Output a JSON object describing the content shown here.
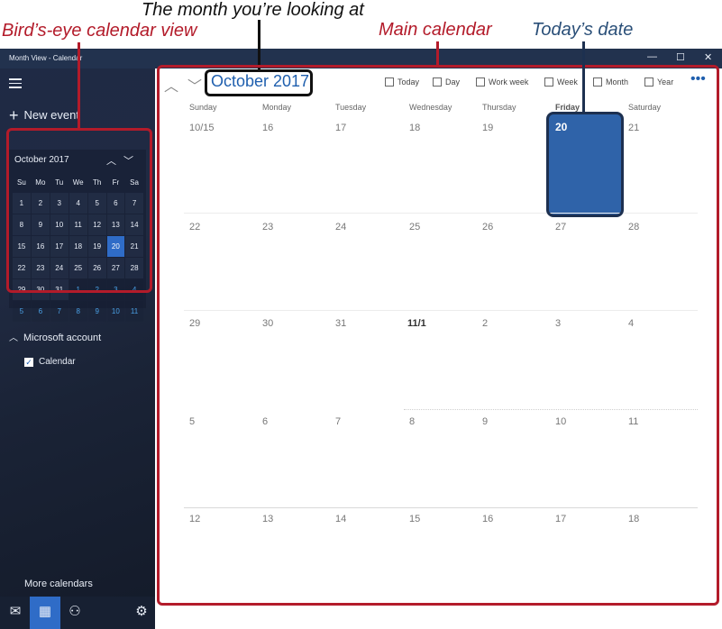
{
  "callouts": {
    "month_looking": "The month you’re looking at",
    "birds_eye": "Bird’s-eye calendar view",
    "main_calendar": "Main calendar",
    "todays_date": "Today’s date"
  },
  "window": {
    "title": "Month View - Calendar",
    "minimize": "—",
    "maximize": "☐",
    "close": "✕"
  },
  "sidebar": {
    "new_event": "New event",
    "mini_calendar": {
      "month": "October 2017",
      "weekdays": [
        "Su",
        "Mo",
        "Tu",
        "We",
        "Th",
        "Fr",
        "Sa"
      ],
      "weeks": [
        [
          "1",
          "2",
          "3",
          "4",
          "5",
          "6",
          "7"
        ],
        [
          "8",
          "9",
          "10",
          "11",
          "12",
          "13",
          "14"
        ],
        [
          "15",
          "16",
          "17",
          "18",
          "19",
          "20",
          "21"
        ],
        [
          "22",
          "23",
          "24",
          "25",
          "26",
          "27",
          "28"
        ],
        [
          "29",
          "30",
          "31",
          "1",
          "2",
          "3",
          "4"
        ],
        [
          "5",
          "6",
          "7",
          "8",
          "9",
          "10",
          "11"
        ]
      ],
      "today_label": "20"
    },
    "account": "Microsoft account",
    "calendar_item": "Calendar",
    "more_calendars": "More calendars"
  },
  "toolbar": {
    "month_title": "October 2017",
    "views": [
      "Today",
      "Day",
      "Work week",
      "Week",
      "Month",
      "Year"
    ],
    "more": "•••"
  },
  "main_calendar": {
    "day_names": [
      "Sunday",
      "Monday",
      "Tuesday",
      "Wednesday",
      "Thursday",
      "Friday",
      "Saturday"
    ],
    "weeks": [
      [
        "10/15",
        "16",
        "17",
        "18",
        "19",
        "20",
        "21"
      ],
      [
        "22",
        "23",
        "24",
        "25",
        "26",
        "27",
        "28"
      ],
      [
        "29",
        "30",
        "31",
        "11/1",
        "2",
        "3",
        "4"
      ],
      [
        "5",
        "6",
        "7",
        "8",
        "9",
        "10",
        "11"
      ],
      [
        "12",
        "13",
        "14",
        "15",
        "16",
        "17",
        "18"
      ]
    ],
    "today": "20"
  },
  "colors": {
    "accent": "#2f6cc7",
    "callout_red": "#b31b2a",
    "callout_blue": "#2a4f78",
    "sidebar_bg": "#1c2436"
  }
}
